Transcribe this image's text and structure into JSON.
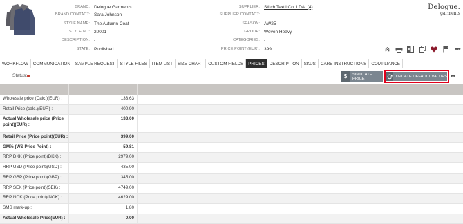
{
  "header": {
    "left": [
      {
        "label": "BRAND:",
        "value": "Delogue Garments"
      },
      {
        "label": "BRAND CONTACT:",
        "value": "Sara Johnson"
      },
      {
        "label": "STYLE NAME:",
        "value": "The Autumn Coat"
      },
      {
        "label": "STYLE NO:",
        "value": "20001"
      },
      {
        "label": "DESCRIPTION:",
        "value": "-"
      },
      {
        "label": "STATE:",
        "value": "Published"
      }
    ],
    "right": [
      {
        "label": "SUPPLIER:",
        "value": "Stitch Textil Co. LDA. (4)"
      },
      {
        "label": "SUPPLIER CONTACT:",
        "value": "-"
      },
      {
        "label": "SEASON:",
        "value": "AW25"
      },
      {
        "label": "GROUP:",
        "value": "Woven Heavy"
      },
      {
        "label": "CATEGORIES:",
        "value": "-"
      },
      {
        "label": "PRICE POINT (EUR):",
        "value": "399"
      }
    ],
    "logo_line1": "Delogue.",
    "logo_line2": "garments",
    "icons": [
      "chevrons-up-icon",
      "print-icon",
      "excel-icon",
      "copy-icon",
      "heart-icon",
      "flag-icon",
      "more-icon"
    ]
  },
  "tabs": [
    {
      "label": "WORKFLOW"
    },
    {
      "label": "COMMUNICATION"
    },
    {
      "label": "SAMPLE REQUEST"
    },
    {
      "label": "STYLE FILES"
    },
    {
      "label": "ITEM LIST"
    },
    {
      "label": "SIZE CHART"
    },
    {
      "label": "CUSTOM FIELDS"
    },
    {
      "label": "PRICES"
    },
    {
      "label": "DESCRIPTION"
    },
    {
      "label": "SKUS"
    },
    {
      "label": "CARE INSTRUCTIONS"
    },
    {
      "label": "COMPLIANCE"
    }
  ],
  "active_tab": "PRICES",
  "status": {
    "label": "Status:"
  },
  "buttons": {
    "simulate_icon": "$",
    "simulate": "SIMULATE PRICE",
    "update": "UPDATE DEFAULT VALUES"
  },
  "colors": {
    "accent_red": "#e0001b",
    "tab_active": "#2e2e2e",
    "button": "#7b8690",
    "status_dot": "#c0392b"
  },
  "prices": [
    {
      "label": "Wholesale price (Calc.)(EUR) :",
      "value": "133.63"
    },
    {
      "label": "Retail Price (calc.)(EUR) :",
      "value": "400.90"
    },
    {
      "label": "Actual Wholesale price (Price point)(EUR) :",
      "value": "133.00"
    },
    {
      "label": "Retail Price (Price point)(EUR) :",
      "value": "399.00"
    },
    {
      "label": "GM% (WS Price Point) :",
      "value": "59.81"
    },
    {
      "label": "RRP DKK (Price point)(DKK) :",
      "value": "2979.00"
    },
    {
      "label": "RRP USD (Price point)(USD) :",
      "value": "435.00"
    },
    {
      "label": "RRP GBP (Price point)(GBP) :",
      "value": "345.00"
    },
    {
      "label": "RRP SEK (Price point)(SEK) :",
      "value": "4749.00"
    },
    {
      "label": "RRP NOK (Price point)(NOK) :",
      "value": "4629.00"
    },
    {
      "label": "SMS mark-up :",
      "value": "1.80"
    },
    {
      "label": "Actual Wholesale Price(EUR) :",
      "value": "0.00"
    }
  ]
}
